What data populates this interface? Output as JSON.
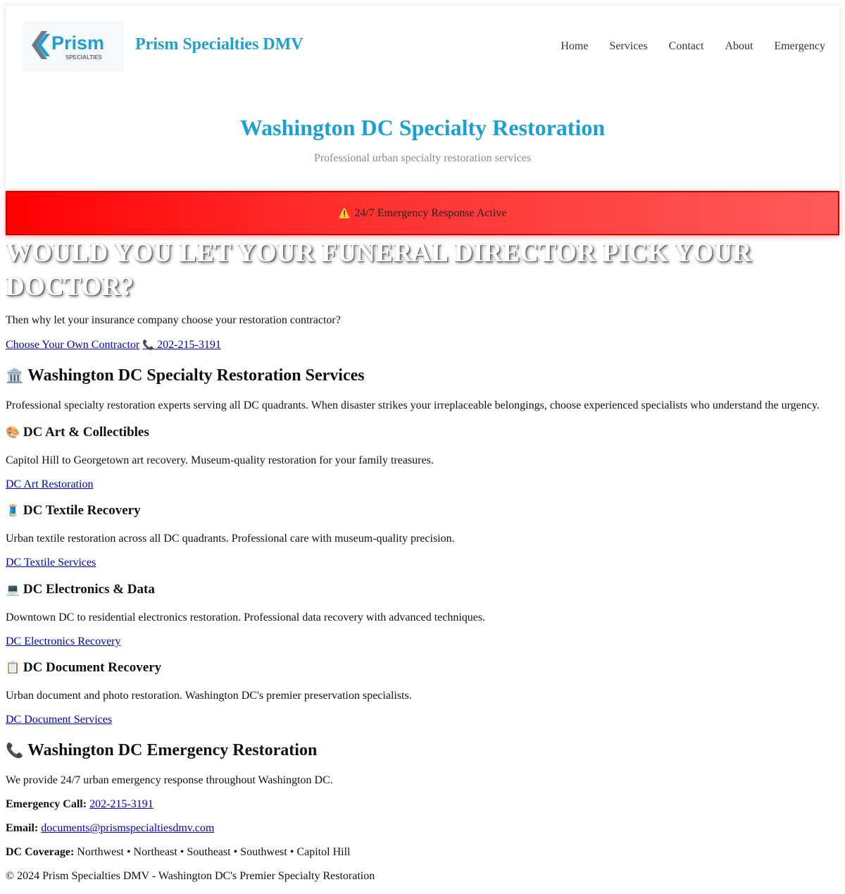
{
  "header": {
    "site_title": "Prism Specialties DMV",
    "logo": {
      "word": "Prism",
      "sub": "SPECIALTIES"
    },
    "nav": [
      "Home",
      "Services",
      "Contact",
      "About",
      "Emergency"
    ],
    "hero_title": "Washington DC Specialty Restoration",
    "hero_subtitle": "Professional urban specialty restoration services"
  },
  "alert": {
    "icon": "warning-icon",
    "text": "24/7 Emergency Response Active"
  },
  "promo": {
    "headline": "Would you let your funeral director pick your doctor?",
    "text": "Then why let your insurance company choose your restoration contractor?",
    "choose_link": "Choose Your Own Contractor",
    "phone_icon": "phone-icon",
    "phone_link": "202-215-3191"
  },
  "services": {
    "heading_icon": "classical-building-icon",
    "heading": "Washington DC Specialty Restoration Services",
    "intro": "Professional specialty restoration experts serving all DC quadrants. When disaster strikes your irreplaceable belongings, choose experienced specialists who understand the urgency.",
    "items": [
      {
        "icon": "palette-icon",
        "title": "DC Art & Collectibles",
        "desc": "Capitol Hill to Georgetown art recovery. Museum-quality restoration for your family treasures.",
        "link": "DC Art Restoration"
      },
      {
        "icon": "thread-spool-icon",
        "title": "DC Textile Recovery",
        "desc": "Urban textile restoration across all DC quadrants. Professional care with museum-quality precision.",
        "link": "DC Textile Services"
      },
      {
        "icon": "laptop-icon",
        "title": "DC Electronics & Data",
        "desc": "Downtown DC to residential electronics restoration. Professional data recovery with advanced techniques.",
        "link": "DC Electronics Recovery"
      },
      {
        "icon": "clipboard-icon",
        "title": "DC Document Recovery",
        "desc": "Urban document and photo restoration. Washington DC's premier preservation specialists.",
        "link": "DC Document Services"
      }
    ]
  },
  "emergency": {
    "heading_icon": "phone-icon",
    "heading": "Washington DC Emergency Restoration",
    "intro": "We provide 24/7 urban emergency response throughout Washington DC.",
    "call_label": "Emergency Call:",
    "call_value": "202-215-3191",
    "email_label": "Email:",
    "email_value": "documents@prismspecialtiesdmv.com",
    "coverage_label": "DC Coverage:",
    "coverage_value": "Northwest • Northeast • Southeast • Southwest • Capitol Hill"
  },
  "footer": {
    "copyright": "© 2024 Prism Specialties DMV - Washington DC's Premier Specialty Restoration"
  }
}
